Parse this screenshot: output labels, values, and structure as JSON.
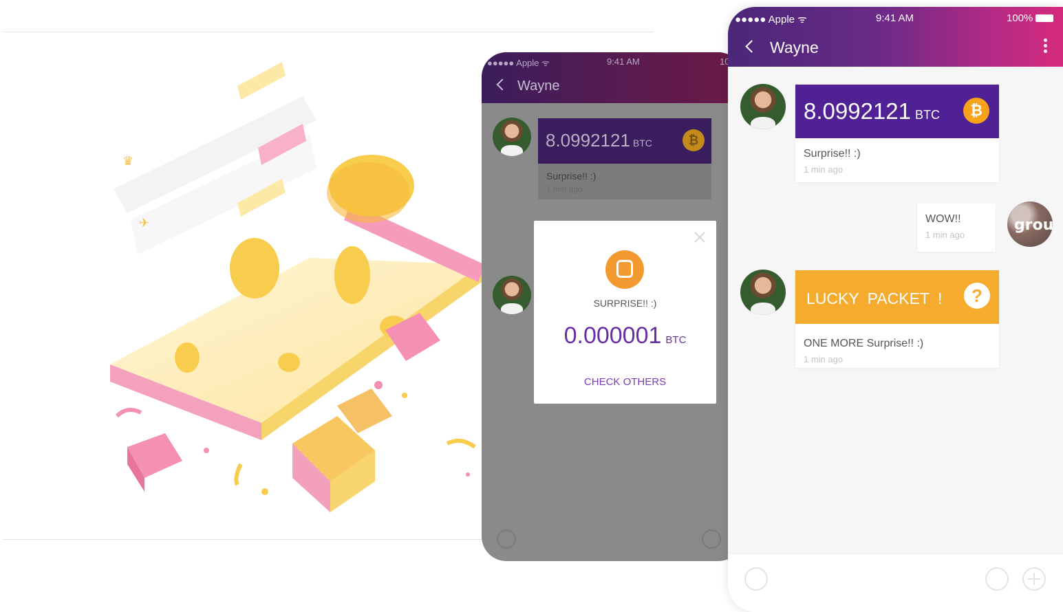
{
  "back_phone": {
    "status": {
      "carrier": "Apple",
      "time": "9:41 AM",
      "battery": "10"
    },
    "title": "Wayne",
    "btc_message": {
      "amount": "8.0992121",
      "unit": "BTC",
      "text": "Surprise!! :)",
      "time": "1 min ago"
    }
  },
  "popup": {
    "label": "SURPRISE!! :)",
    "amount": "0.000001",
    "unit": "BTC",
    "action": "CHECK OTHERS"
  },
  "front_phone": {
    "status": {
      "carrier": "Apple",
      "time": "9:41 AM",
      "battery": "100%"
    },
    "title": "Wayne",
    "messages": [
      {
        "amount": "8.0992121",
        "unit": "BTC",
        "text": "Surprise!! :)",
        "time": "1 min ago"
      },
      {
        "text": "WOW!!",
        "time": "1 min ago",
        "avatar_text": "grou"
      },
      {
        "title": "LUCKY PACKET !",
        "text": "ONE MORE Surprise!! :)",
        "time": "1 min ago"
      }
    ]
  },
  "icons": [
    "back-chevron-icon",
    "more-menu-icon",
    "bitcoin-icon",
    "help-icon",
    "close-icon",
    "emoji-icon",
    "mic-icon",
    "plus-icon",
    "red-packet-icon"
  ],
  "colors": {
    "purple": "#4f2194",
    "magenta": "#d62a7c",
    "orange": "#f5ac2e",
    "coin": "#f7a21b"
  }
}
